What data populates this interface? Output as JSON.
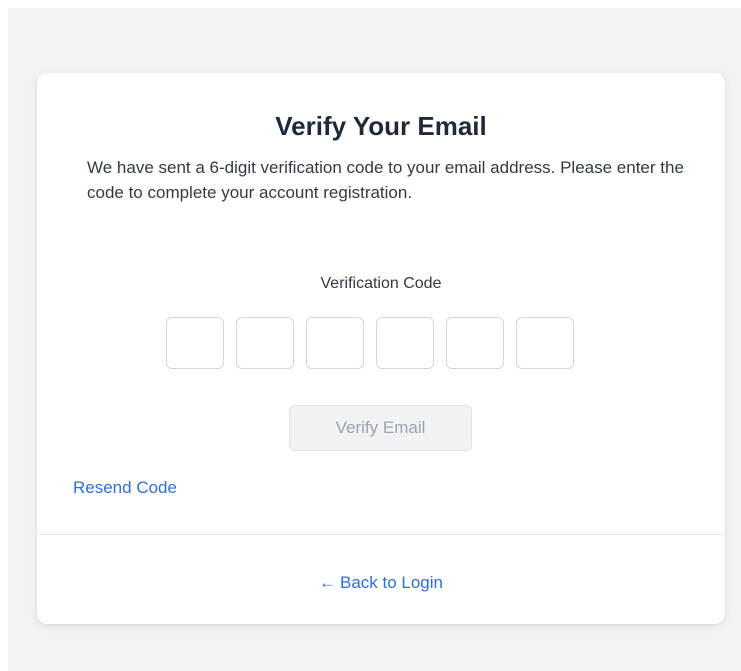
{
  "card": {
    "title": "Verify Your Email",
    "description": "We have sent a 6-digit verification code to your email address. Please enter the code to complete your account registration.",
    "code_label": "Verification Code",
    "code_digits": [
      "",
      "",
      "",
      "",
      "",
      ""
    ],
    "verify_button_label": "Verify Email",
    "resend_link_label": "Resend Code",
    "back_arrow": "←",
    "back_link_label": "Back to Login"
  },
  "colors": {
    "accent": "#2f6fd6",
    "background": "#f2f3f5",
    "card": "#ffffff",
    "disabled_button": "#f1f2f4"
  }
}
